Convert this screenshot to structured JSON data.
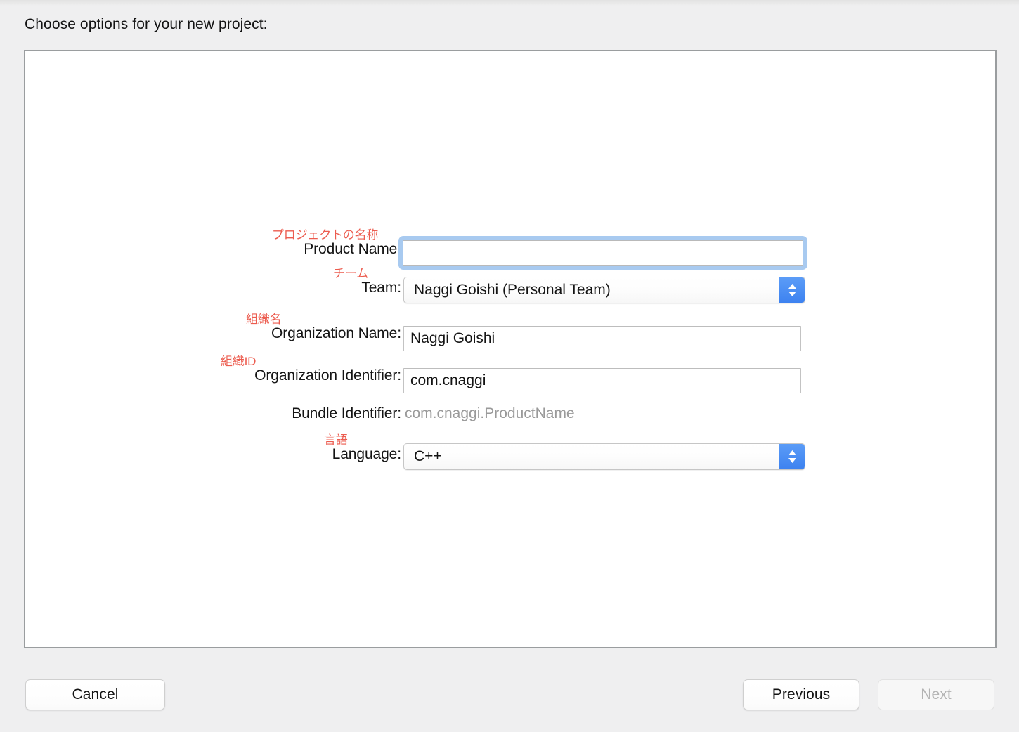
{
  "window": {
    "prompt": "Choose options for your new project:"
  },
  "form": {
    "fields": [
      {
        "id": "product-name",
        "label": "Product Name:",
        "annotation": "プロジェクトの名称",
        "control": "text",
        "value": "",
        "placeholder": ""
      },
      {
        "id": "team",
        "label": "Team:",
        "annotation": "チーム",
        "control": "popup",
        "value": "Naggi Goishi (Personal Team)"
      },
      {
        "id": "organization-name",
        "label": "Organization Name:",
        "annotation": "組織名",
        "control": "text",
        "value": "Naggi Goishi",
        "placeholder": ""
      },
      {
        "id": "organization-identifier",
        "label": "Organization Identifier:",
        "annotation": "組織ID",
        "control": "text",
        "value": "com.cnaggi",
        "placeholder": ""
      },
      {
        "id": "bundle-identifier",
        "label": "Bundle Identifier:",
        "annotation": "",
        "control": "static",
        "value": "com.cnaggi.ProductName"
      },
      {
        "id": "language",
        "label": "Language:",
        "annotation": "言語",
        "control": "popup",
        "value": "C++"
      }
    ]
  },
  "footer": {
    "cancel_label": "Cancel",
    "previous_label": "Previous",
    "next_label": "Next",
    "next_disabled": true
  },
  "colors": {
    "annotation_red": "#ec5c4f",
    "focus_ring_blue": "#a8caf0",
    "stepper_blue": "#3d82f0",
    "window_background": "#efeff0",
    "panel_background": "#ffffff",
    "muted_text": "#9a9a9a"
  },
  "icons": {
    "stepper": "chevron-up-down-icon"
  }
}
